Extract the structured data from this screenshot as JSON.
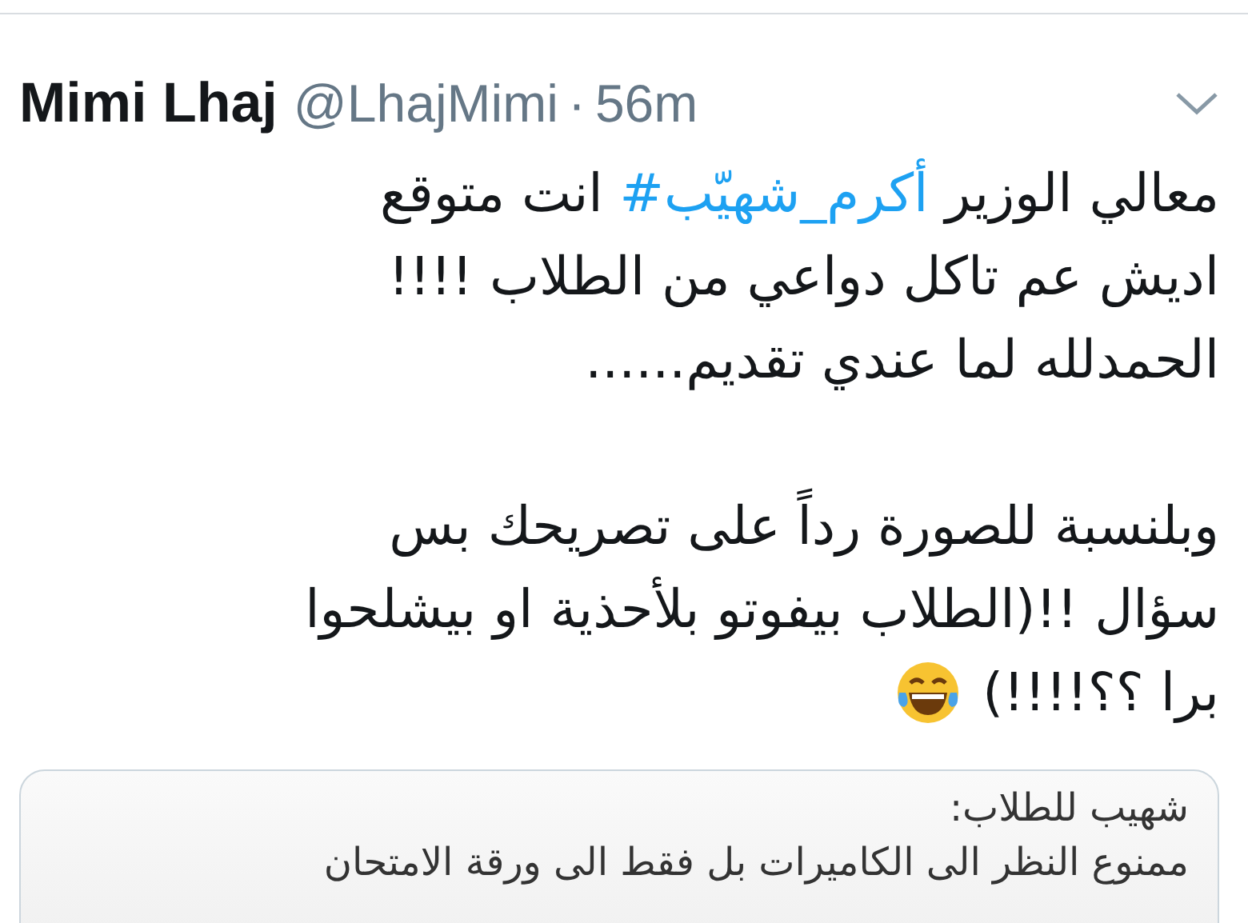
{
  "tweet": {
    "name": "Mimi Lhaj",
    "handle": "@LhajMimi",
    "separator": "·",
    "time": "56m",
    "paragraphs": [
      {
        "lines": [
          {
            "before": "معالي الوزير ",
            "hashtag": "#أكرم_شهيّب",
            "after": " انت متوقع"
          },
          {
            "text": "اديش عم تاكل دواعي من الطلاب !!!!"
          },
          {
            "text": "الحمدلله لما عندي تقديم......"
          }
        ]
      },
      {
        "lines": [
          {
            "text": "وبلنسبة للصورة رداً على تصريحك بس"
          },
          {
            "text": "سؤال !!(الطلاب بيفوتو بلأحذية او بيشلحوا"
          },
          {
            "text": "برا ؟؟!!!!)",
            "emoji": true
          }
        ]
      }
    ],
    "quote": {
      "lines": [
        "شهيب للطلاب:",
        "ممنوع النظر الى الكاميرات بل فقط الى ورقة الامتحان"
      ]
    }
  }
}
